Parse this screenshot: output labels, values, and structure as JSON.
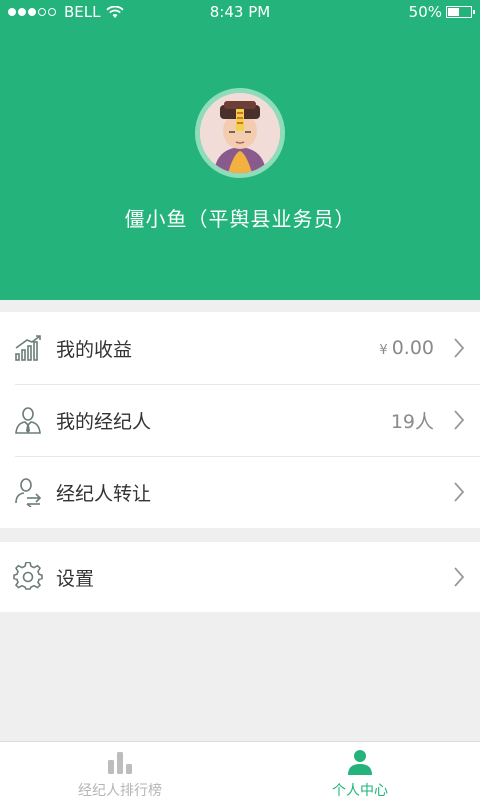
{
  "status_bar": {
    "carrier": "BELL",
    "time": "8:43 PM",
    "battery": "50%",
    "battery_level": 0.5
  },
  "profile": {
    "username": "僵小鱼（平舆县业务员）"
  },
  "menu": {
    "earnings": {
      "label": "我的收益",
      "currency": "¥",
      "value": "0.00",
      "icon": "chart-bars-icon"
    },
    "brokers": {
      "label": "我的经纪人",
      "value": "19人",
      "icon": "person-tie-icon"
    },
    "transfer": {
      "label": "经纪人转让",
      "icon": "person-transfer-icon"
    },
    "settings": {
      "label": "设置",
      "icon": "gear-icon"
    }
  },
  "tabbar": {
    "ranking": {
      "label": "经纪人排行榜",
      "icon": "bar-chart-icon"
    },
    "personal": {
      "label": "个人中心",
      "icon": "person-icon",
      "active": true
    }
  },
  "colors": {
    "brand": "#23b37b",
    "inactive": "#b5b5b5"
  }
}
